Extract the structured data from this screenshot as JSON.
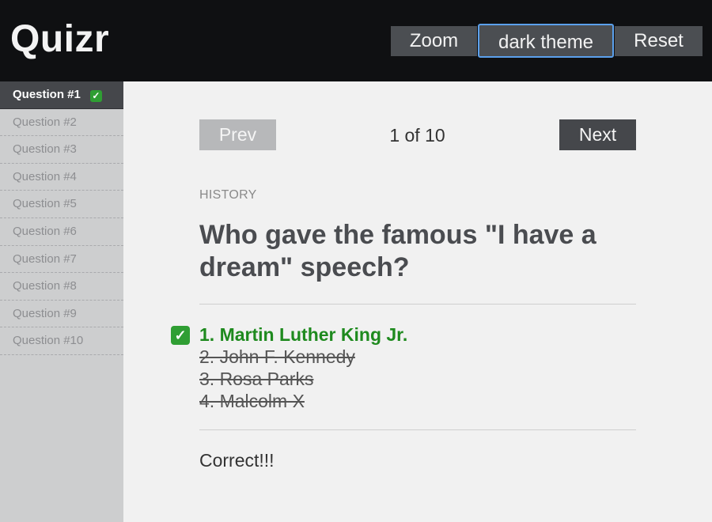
{
  "app": {
    "title": "Quizr"
  },
  "header": {
    "zoom_label": "Zoom",
    "theme_label": "dark theme",
    "reset_label": "Reset"
  },
  "sidebar": {
    "items": [
      {
        "label": "Question #1",
        "status": "correct",
        "active": true
      },
      {
        "label": "Question #2"
      },
      {
        "label": "Question #3"
      },
      {
        "label": "Question #4"
      },
      {
        "label": "Question #5"
      },
      {
        "label": "Question #6"
      },
      {
        "label": "Question #7"
      },
      {
        "label": "Question #8"
      },
      {
        "label": "Question #9"
      },
      {
        "label": "Question #10"
      }
    ]
  },
  "nav": {
    "prev_label": "Prev",
    "next_label": "Next",
    "counter": "1 of 10"
  },
  "question": {
    "category": "HISTORY",
    "text": "Who gave the famous \"I have a dream\" speech?",
    "answers": [
      {
        "label": "1. Martin Luther King Jr.",
        "state": "correct"
      },
      {
        "label": "2. John F. Kennedy",
        "state": "eliminated"
      },
      {
        "label": "3. Rosa Parks",
        "state": "eliminated"
      },
      {
        "label": "4. Malcolm X",
        "state": "eliminated"
      }
    ],
    "feedback": "Correct!!!"
  },
  "icons": {
    "check": "check-mark-icon"
  },
  "colors": {
    "correct": "#1e8a1e",
    "check_bg": "#2f9e33",
    "focus_outline": "#5ba0ec"
  }
}
